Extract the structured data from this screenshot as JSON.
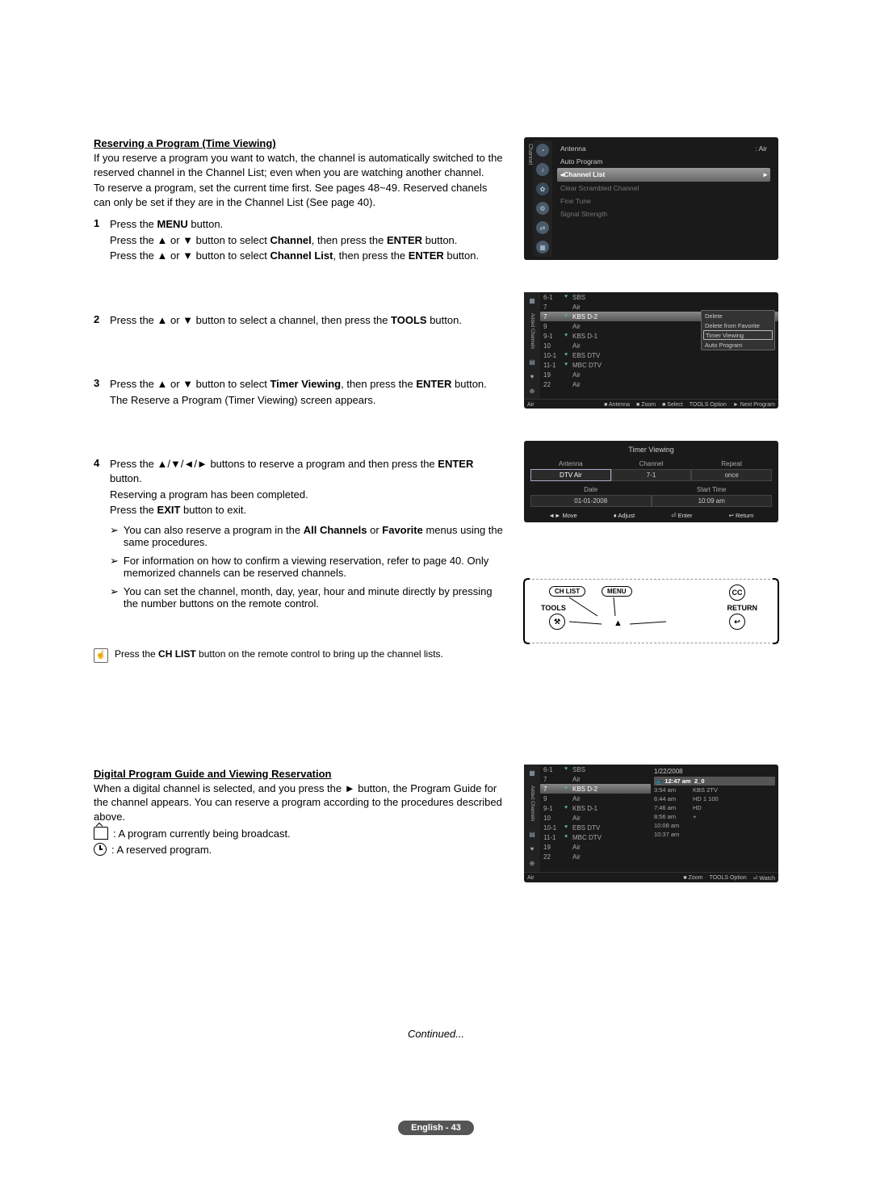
{
  "section1": {
    "title": "Reserving a Program (Time Viewing)",
    "intro1": "If you reserve a program you want to watch, the channel is automatically switched to the reserved channel in the Channel List; even when you are watching another channel.",
    "intro2": "To reserve a program, set the current time first. See pages 48~49. Reserved chanels can only be set if they are in the Channel List (See page 40).",
    "steps": [
      {
        "n": "1",
        "lines": [
          "Press the <b>MENU</b> button.",
          "Press the ▲ or ▼ button to select <b>Channel</b>, then press the <b>ENTER</b> button.",
          "Press the ▲ or ▼ button to select <b>Channel List</b>, then press the <b>ENTER</b> button."
        ]
      },
      {
        "n": "2",
        "lines": [
          "Press the ▲ or ▼ button to select a channel, then press the <b>TOOLS</b> button."
        ]
      },
      {
        "n": "3",
        "lines": [
          "Press the ▲ or ▼ button to select <b>Timer Viewing</b>, then press the <b>ENTER</b> button.",
          "The Reserve a Program (Timer Viewing) screen appears."
        ]
      },
      {
        "n": "4",
        "lines": [
          "Press the ▲/▼/◄/► buttons to reserve a program and then press the <b>ENTER</b> button.",
          "Reserving a program has been completed.",
          "Press the <b>EXIT</b> button to exit."
        ],
        "bullets": [
          "You can also reserve a program in the <b>All Channels</b> or <b>Favorite</b> menus using the same procedures.",
          "For information on how to confirm a viewing reservation, refer to page 40. Only memorized channels can be reserved channels.",
          "You can set the channel, month, day, year, hour and minute directly by pressing the number buttons on the remote control."
        ]
      }
    ],
    "note": "Press the <b>CH LIST</b> button on the remote control to bring up the channel lists."
  },
  "osd1": {
    "tabLabel": "Channel",
    "rows": [
      {
        "l": "Antenna",
        "r": ": Air"
      },
      {
        "l": "Auto Program",
        "r": ""
      }
    ],
    "hl": "Channel List",
    "dim": [
      "Clear Scrambled Channel",
      "Fine Tune",
      "Signal Strength"
    ]
  },
  "osd2": {
    "leftLabel": "Added Channels",
    "channels": [
      {
        "num": "6-1",
        "heart": "♥",
        "name": "SBS"
      },
      {
        "num": "7",
        "heart": "",
        "name": "Air"
      },
      {
        "num": "7",
        "heart": "♥",
        "name": "KBS D-2",
        "hl": true
      },
      {
        "num": "9",
        "heart": "",
        "name": "Air"
      },
      {
        "num": "9-1",
        "heart": "♥",
        "name": "KBS D-1"
      },
      {
        "num": "10",
        "heart": "",
        "name": "Air"
      },
      {
        "num": "10-1",
        "heart": "♥",
        "name": "EBS DTV"
      },
      {
        "num": "11-1",
        "heart": "♥",
        "name": "MBC DTV"
      },
      {
        "num": "19",
        "heart": "",
        "name": "Air"
      },
      {
        "num": "22",
        "heart": "",
        "name": "Air"
      }
    ],
    "toolsMenu": [
      "Delete",
      "Delete from Favorite",
      "Timer Viewing",
      "Auto Program"
    ],
    "toolsHlIndex": 2,
    "footerLeft": "Air",
    "footer": [
      "■ Antenna",
      "■ Zoom",
      "■ Select",
      "TOOLS Option",
      "► Next Program"
    ]
  },
  "timer": {
    "title": "Timer Viewing",
    "hdr1": [
      "Antenna",
      "Channel",
      "Repeat"
    ],
    "val1": [
      "DTV Air",
      "7-1",
      "once"
    ],
    "hdr2": [
      "Date",
      "Start Time"
    ],
    "val2": [
      "01-01-2008",
      "10:09 am"
    ],
    "footer": [
      "◄► Move",
      "♦ Adjust",
      "⏎ Enter",
      "↩ Return"
    ]
  },
  "remote": {
    "chlist": "CH LIST",
    "menu": "MENU",
    "cc": "CC",
    "tools": "TOOLS",
    "return": "RETURN"
  },
  "section2": {
    "title": "Digital Program Guide and Viewing Reservation",
    "intro": "When a digital channel is selected, and you press the ► button, the Program Guide for the channel appears. You can reserve a program according to the procedures described above.",
    "iconLines": [
      ": A program currently being broadcast.",
      ": A reserved program."
    ]
  },
  "osd3": {
    "leftLabel": "Added Channels",
    "channels": [
      {
        "num": "6-1",
        "heart": "♥",
        "name": "SBS"
      },
      {
        "num": "7",
        "heart": "",
        "name": "Air"
      },
      {
        "num": "7",
        "heart": "♥",
        "name": "KBS D-2",
        "hl": true
      },
      {
        "num": "9",
        "heart": "",
        "name": "Air"
      },
      {
        "num": "9-1",
        "heart": "♥",
        "name": "KBS D-1"
      },
      {
        "num": "10",
        "heart": "",
        "name": "Air"
      },
      {
        "num": "10-1",
        "heart": "♥",
        "name": "EBS DTV"
      },
      {
        "num": "11-1",
        "heart": "♥",
        "name": "MBC DTV"
      },
      {
        "num": "19",
        "heart": "",
        "name": "Air"
      },
      {
        "num": "22",
        "heart": "",
        "name": "Air"
      }
    ],
    "guideDate": "1/22/2008",
    "guideHl": {
      "time": "📺 12:47 am",
      "prog": "2_0"
    },
    "guide": [
      {
        "time": "3:54 am",
        "prog": "KBS 2TV"
      },
      {
        "time": "6:44 am",
        "prog": "HD 1 100"
      },
      {
        "time": "7:46 am",
        "prog": "HD"
      },
      {
        "time": "8:56 am",
        "prog": "+"
      },
      {
        "time": "10:08 am",
        "prog": ""
      },
      {
        "time": "10:37 am",
        "prog": ""
      }
    ],
    "footerLeft": "Air",
    "footer": [
      "■ Zoom",
      "TOOLS Option",
      "⏎ Watch"
    ]
  },
  "continued": "Continued...",
  "pageFooter": "English - 43"
}
